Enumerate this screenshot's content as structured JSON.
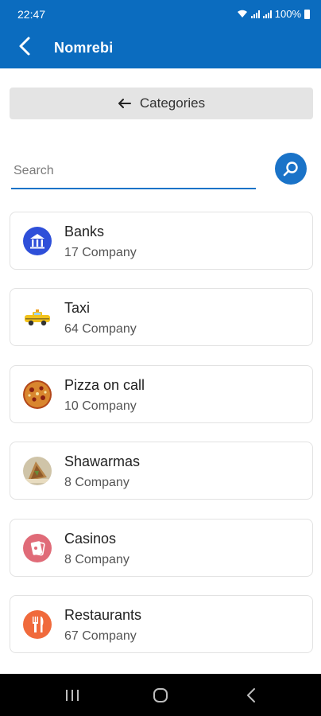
{
  "status_bar": {
    "time": "22:47",
    "battery_label": "100%",
    "icons": [
      "wifi-icon",
      "volte-icon",
      "signal-icon",
      "battery-icon"
    ]
  },
  "app_bar": {
    "title": "Nomrebi",
    "back_icon": "chevron-left-icon"
  },
  "categories_button": {
    "label": "Categories",
    "icon": "arrow-left-icon"
  },
  "search": {
    "placeholder": "Search",
    "value": "",
    "icon": "search-icon"
  },
  "categories": [
    {
      "name": "Banks",
      "count": "17 Company",
      "icon": "bank-icon",
      "color": "#2e4fd9"
    },
    {
      "name": "Taxi",
      "count": "64 Company",
      "icon": "taxi-icon",
      "color": "#f2c21b"
    },
    {
      "name": "Pizza on call",
      "count": "10 Company",
      "icon": "pizza-icon",
      "color": "#b3471a"
    },
    {
      "name": "Shawarmas",
      "count": "8 Company",
      "icon": "shawarma-icon",
      "color": "#b8864a"
    },
    {
      "name": "Casinos",
      "count": "8 Company",
      "icon": "casino-icon",
      "color": "#e06b78"
    },
    {
      "name": "Restaurants",
      "count": "67 Company",
      "icon": "restaurant-icon",
      "color": "#f06a3c"
    }
  ],
  "nav_bar": {
    "buttons": [
      "recents-icon",
      "home-icon",
      "back-icon"
    ]
  },
  "colors": {
    "primary": "#0b6cbf",
    "accent": "#1a73c8"
  }
}
